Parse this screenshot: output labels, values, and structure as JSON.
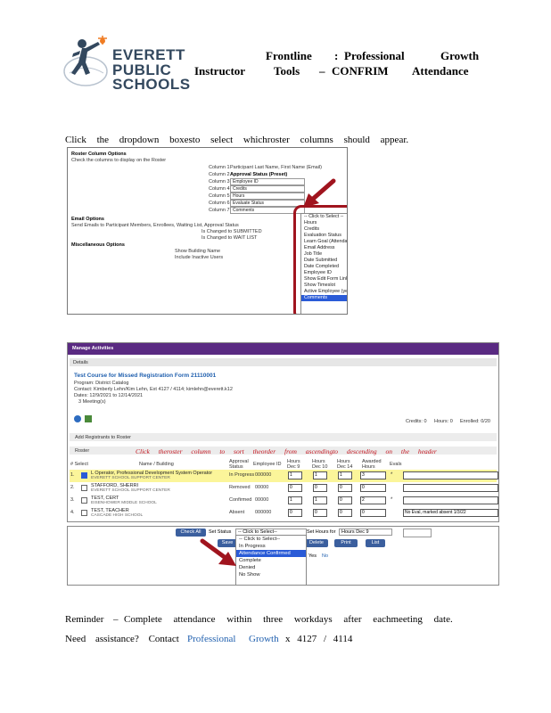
{
  "brand": {
    "line1": "EVERETT",
    "line2": "PUBLIC",
    "line3": "SCHOOLS"
  },
  "header": {
    "frontline": "Frontline",
    "colon": ":",
    "professional": "Professional",
    "growth": "Growth",
    "instructor": "Instructor",
    "tools": "Tools",
    "dash": "–",
    "confrim": "CONFRIM",
    "attendance": "Attendance"
  },
  "instruction": "Click the dropdown boxesto select whichroster columns should appear.",
  "shot1": {
    "section_title": "Roster Column Options",
    "section_desc": "Check the columns to display on the Roster",
    "col1_label": "Column 1",
    "col1_value": "Participant Last Name, First Name (Email)",
    "col2_label": "Column 2",
    "col2_value": "Approval Status (Preset)",
    "col3_label": "Column 3",
    "col3_value": "Employee ID",
    "col4_label": "Column 4",
    "col4_value": "Credits",
    "col5_label": "Column 5",
    "col5_value": "Hours",
    "col6_label": "Column 6",
    "col6_value": "Evaluate Status",
    "col7_label": "Column 7",
    "col7_value": "Comments",
    "email_title": "Email Options",
    "email_desc": "Send Emails to Participant Members, Enrollees, Waiting List, Approval Status",
    "email_status": "Is Changed to SUBMITTED",
    "email_wait": "Is Changed to WAIT LIST",
    "misc_title": "Miscellaneous Options",
    "misc_1": "Show Building Name",
    "misc_2": "Include Inactive Users",
    "dropdown_options": [
      "-- Click to Select --",
      "Hours",
      "Credits",
      "Evaluation Status",
      "Learn Goal (Attendance)",
      "Email Address",
      "Job Title",
      "Date Submitted",
      "Date Completed",
      "Employee ID",
      "Show Edit Form Link",
      "Show Timeslot",
      "Active Employee (yes/no)",
      "Comments"
    ]
  },
  "shot2": {
    "bar_title": "Manage Activities",
    "details": "Details",
    "course_title": "Test Course for Missed Registration Form 21110001",
    "program": "Program: District Catalog",
    "contact": "Contact: Kimberly Lehn/Kim Lehn, Ext 4127 / 4114; kimlehn@everett.k12",
    "dates": "Dates: 12/9/2021 to 12/14/2021",
    "meetings": "3 Meeting(s)",
    "credits": "Credits: 0",
    "hours": "Hours: 0",
    "enrolled": "Enrolled: 0/20",
    "add_registrants": "Add Registrants to Roster",
    "roster": "Roster",
    "annotation": "Click theroster column to sort theorder from ascendingto descending on the header",
    "col_select": "# Select",
    "col_name": "Name / Building",
    "col_status": "Approval Status",
    "col_empid": "Employee ID",
    "col_h1": "Hours Dec 9",
    "col_h2": "Hours Dec 10",
    "col_h3": "Hours Dec 14",
    "col_awarded": "Awarded Hours",
    "col_evals": "Evals",
    "rows": [
      {
        "num": "1.",
        "name": "L Operator, Professional Development System Operator",
        "building": "EVERETT SCHOOL SUPPORT CENTER",
        "status": "In Progress",
        "empid": "000000",
        "h1": "1",
        "h2": "1",
        "h3": "1",
        "awarded": "3",
        "star": "*",
        "eval": ""
      },
      {
        "num": "2.",
        "name": "STAFFORD, SHERRI",
        "building": "EVERETT SCHOOL SUPPORT CENTER",
        "status": "Removed",
        "empid": "00000",
        "h1": "0",
        "h2": "0",
        "h3": "0",
        "awarded": "0",
        "star": "",
        "eval": ""
      },
      {
        "num": "3.",
        "name": "TEST, CERT",
        "building": "EISENHOWER MIDDLE SCHOOL",
        "status": "Confirmed",
        "empid": "00000",
        "h1": "1",
        "h2": "1",
        "h3": "0",
        "awarded": "2",
        "star": "*",
        "eval": ""
      },
      {
        "num": "4.",
        "name": "TEST, TEACHER",
        "building": "CASCADE HIGH SCHOOL",
        "status": "Absent",
        "empid": "000000",
        "h1": "0",
        "h2": "0",
        "h3": "0",
        "awarded": "0",
        "star": "",
        "eval": "No Eval, marked absent 1/3/22"
      }
    ]
  },
  "shot3": {
    "check_all": "Check All",
    "set_status": "Set Status",
    "status_select": "-- Click to Select--",
    "set_hours": "Set Hours for",
    "hours_select": "Hours Dec 9",
    "save": "Save",
    "delete": "Delete",
    "print": "Print",
    "list": "List",
    "email_yes": "Yes",
    "email_no": "No",
    "options": [
      "-- Click to Select--",
      "In Progress",
      "Attendance Confirmed",
      "Complete",
      "Denied",
      "No Show"
    ]
  },
  "reminder": {
    "lead": "Reminder",
    "dash": "–",
    "text": "Complete attendance within three workdays after eachmeeting date."
  },
  "assist": {
    "lead": "Need assistance? Contact",
    "link1": "Professional",
    "link2": "Growth",
    "ext": "x 4127 / 4114"
  },
  "colors": {
    "accent_red": "#a0141e",
    "purple": "#5a2a82",
    "link_blue": "#1f5fae",
    "highlight": "#2a5bd7"
  }
}
